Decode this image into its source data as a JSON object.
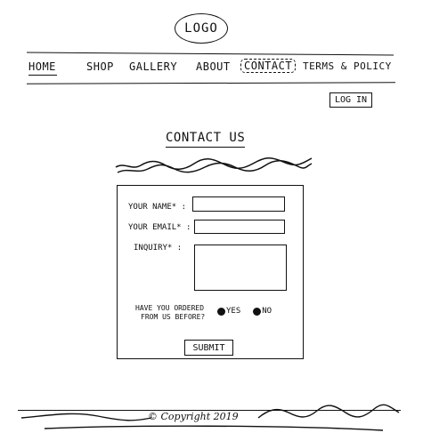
{
  "logo": {
    "text": "LOGO"
  },
  "nav": {
    "items": [
      {
        "label": "HOME"
      },
      {
        "label": "SHOP"
      },
      {
        "label": "GALLERY"
      },
      {
        "label": "ABOUT"
      },
      {
        "label": "CONTACT",
        "active": true
      },
      {
        "label": "TERMS & POLICY"
      }
    ]
  },
  "login": {
    "label": "LOG IN"
  },
  "page": {
    "title": "CONTACT US"
  },
  "form": {
    "name_label": "YOUR NAME* :",
    "email_label": "YOUR EMAIL* :",
    "inquiry_label": "INQUIRY* :",
    "ordered_question_line1": "HAVE YOU ORDERED",
    "ordered_question_line2": "FROM US BEFORE?",
    "option_yes": "YES",
    "option_no": "NO",
    "submit_label": "SUBMIT",
    "name_value": "",
    "email_value": "",
    "inquiry_value": ""
  },
  "footer": {
    "copyright": "© Copyright 2019"
  }
}
